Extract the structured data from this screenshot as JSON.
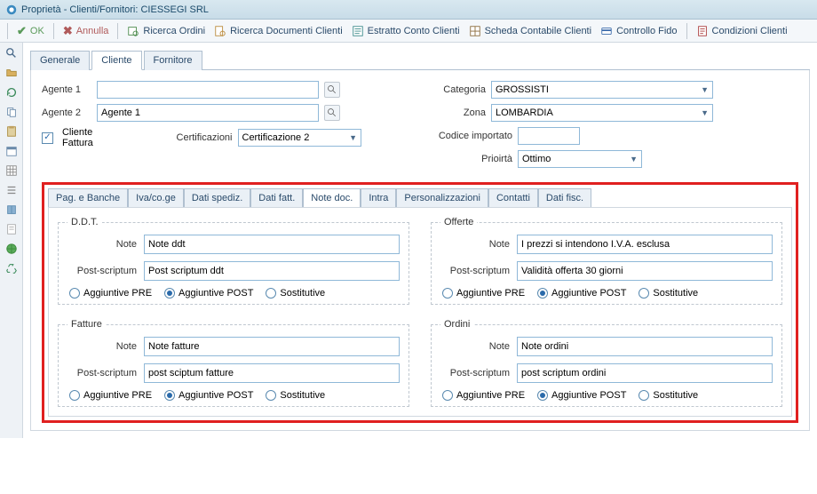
{
  "window": {
    "title": "Proprietà - Clienti/Fornitori: CIESSEGI SRL"
  },
  "toolbar": {
    "ok": "OK",
    "annulla": "Annulla",
    "ricerca_ordini": "Ricerca Ordini",
    "ricerca_doc_clienti": "Ricerca Documenti Clienti",
    "estratto_conto": "Estratto Conto Clienti",
    "scheda_contabile": "Scheda Contabile Clienti",
    "controllo_fido": "Controllo Fido",
    "condizioni_clienti": "Condizioni Clienti"
  },
  "tabs": {
    "generale": "Generale",
    "cliente": "Cliente",
    "fornitore": "Fornitore"
  },
  "form": {
    "agente1_label": "Agente 1",
    "agente1_value": "",
    "agente2_label": "Agente 2",
    "agente2_value": "Agente 1",
    "cliente_fattura_label": "Cliente Fattura",
    "certificazioni_label": "Certificazioni",
    "certificazioni_value": "Certificazione 2",
    "categoria_label": "Categoria",
    "categoria_value": "GROSSISTI",
    "zona_label": "Zona",
    "zona_value": "LOMBARDIA",
    "codice_importato_label": "Codice importato",
    "codice_importato_value": "",
    "priorita_label": "Prioirtà",
    "priorita_value": "Ottimo"
  },
  "subtabs": {
    "pag_banche": "Pag. e Banche",
    "iva_coge": "Iva/co.ge",
    "dati_spediz": "Dati spediz.",
    "dati_fatt": "Dati fatt.",
    "note_doc": "Note doc.",
    "intra": "Intra",
    "personalizzazioni": "Personalizzazioni",
    "contatti": "Contatti",
    "dati_fisc": "Dati fisc."
  },
  "labels": {
    "note": "Note",
    "post_scriptum": "Post-scriptum",
    "agg_pre": "Aggiuntive PRE",
    "agg_post": "Aggiuntive POST",
    "sostitutive": "Sostitutive"
  },
  "groups": {
    "ddt": {
      "legend": "D.D.T.",
      "note": "Note ddt",
      "ps": "Post scriptum ddt",
      "sel": "post"
    },
    "offerte": {
      "legend": "Offerte",
      "note": "I prezzi si intendono I.V.A. esclusa",
      "ps": "Validità offerta 30 giorni",
      "sel": "post"
    },
    "fatture": {
      "legend": "Fatture",
      "note": "Note fatture",
      "ps": "post sciptum fatture",
      "sel": "post"
    },
    "ordini": {
      "legend": "Ordini",
      "note": "Note ordini",
      "ps": "post scriptum ordini",
      "sel": "post"
    }
  }
}
